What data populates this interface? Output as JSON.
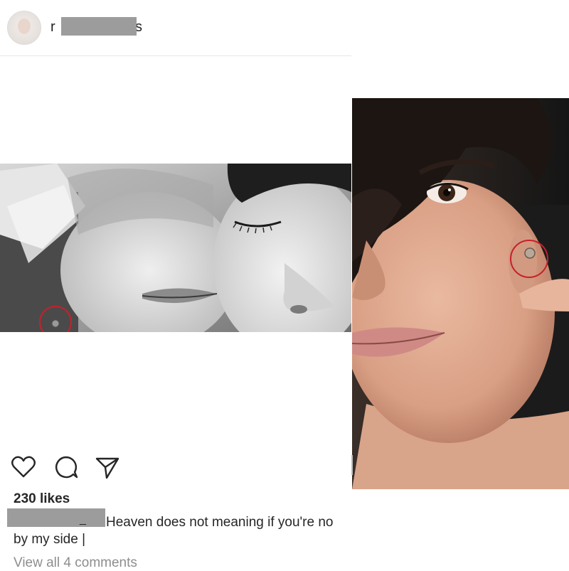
{
  "post": {
    "username_visible_start": "r",
    "username_visible_end": "s",
    "likes": "230 likes",
    "caption_text": "Heaven does not meaning if you're no",
    "caption_line2": "by my side |",
    "caption_underscore": "_",
    "view_comments": "View all 4 comments"
  },
  "icons": {
    "like": "heart-icon",
    "comment": "comment-icon",
    "share": "share-icon"
  },
  "colors": {
    "highlight_circle": "#c8202a",
    "redaction": "#9c9c9c",
    "text": "#262626",
    "muted_text": "#8e8e8e"
  }
}
